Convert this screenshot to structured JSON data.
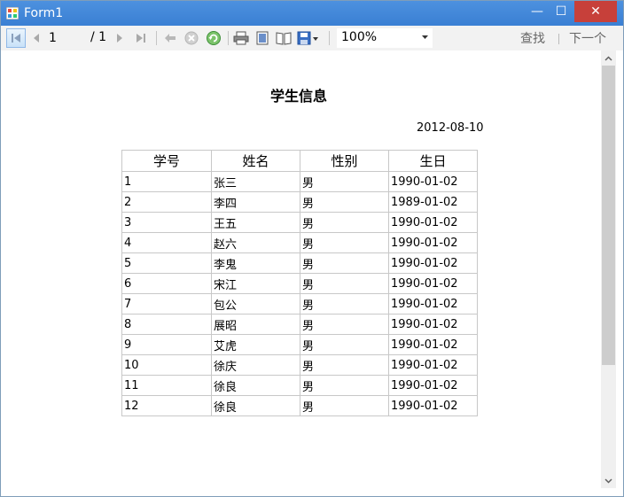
{
  "window": {
    "title": "Form1",
    "minimize_glyph": "—",
    "maximize_glyph": "☐",
    "close_glyph": "✕"
  },
  "toolbar": {
    "current_page": "1",
    "total_pages": "/ 1",
    "zoom": "100%",
    "find_label": "查找",
    "next_label": "下一个",
    "icons": [
      "first-page-icon",
      "prev-page-icon",
      "next-page-icon",
      "last-page-icon",
      "back-icon",
      "stop-icon",
      "refresh-icon",
      "print-icon",
      "print-layout-icon",
      "page-setup-icon",
      "export-icon"
    ]
  },
  "report": {
    "title": "学生信息",
    "date": "2012-08-10",
    "columns": [
      "学号",
      "姓名",
      "性别",
      "生日"
    ],
    "rows": [
      [
        "1",
        "张三",
        "男",
        "1990-01-02"
      ],
      [
        "2",
        "李四",
        "男",
        "1989-01-02"
      ],
      [
        "3",
        "王五",
        "男",
        "1990-01-02"
      ],
      [
        "4",
        "赵六",
        "男",
        "1990-01-02"
      ],
      [
        "5",
        "李鬼",
        "男",
        "1990-01-02"
      ],
      [
        "6",
        "宋江",
        "男",
        "1990-01-02"
      ],
      [
        "7",
        "包公",
        "男",
        "1990-01-02"
      ],
      [
        "8",
        "展昭",
        "男",
        "1990-01-02"
      ],
      [
        "9",
        "艾虎",
        "男",
        "1990-01-02"
      ],
      [
        "10",
        "徐庆",
        "男",
        "1990-01-02"
      ],
      [
        "11",
        "徐良",
        "男",
        "1990-01-02"
      ],
      [
        "12",
        "徐良",
        "男",
        "1990-01-02"
      ]
    ]
  },
  "colors": {
    "titlebar": "#3a7fd3",
    "close_button": "#c7403a",
    "grid_border": "#c8c8c8"
  }
}
